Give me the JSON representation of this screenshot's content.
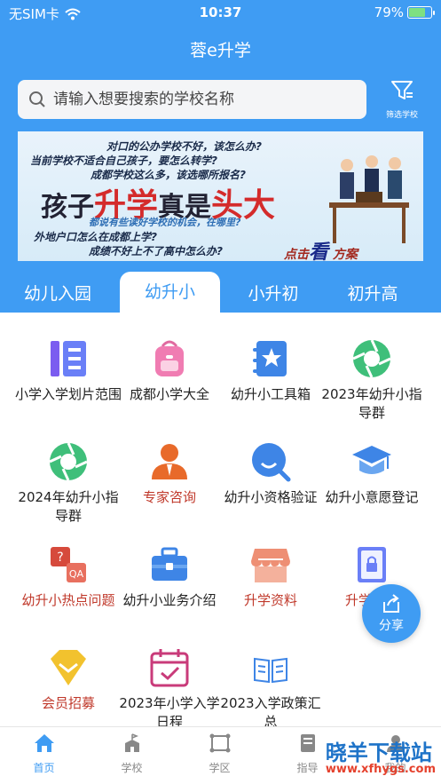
{
  "status": {
    "carrier": "无SIM卡",
    "time": "10:37",
    "battery": "79%",
    "battery_level": 0.79
  },
  "app": {
    "title": "蓉e升学"
  },
  "search": {
    "placeholder": "请输入想要搜索的学校名称",
    "filter_label": "筛选学校"
  },
  "banner": {
    "line1": "对口的公办学校不好，该怎么办?",
    "line2": "当前学校不适合自己孩子，要怎么转学?",
    "line3": "成都学校这么多，该选哪所报名?",
    "headline_a": "孩子",
    "headline_b": "升学",
    "headline_c": "真是",
    "headline_d": "头大",
    "line4": "都说有些读好学校的机会，在哪里?",
    "line5": "外地户口怎么在成都上学?",
    "line6": "成绩不好上不了高中怎么办?",
    "cta_a": "点击",
    "cta_b": "看",
    "cta_c": "方案"
  },
  "tabs": [
    {
      "label": "幼儿入园"
    },
    {
      "label": "幼升小"
    },
    {
      "label": "小升初"
    },
    {
      "label": "初升高"
    }
  ],
  "grid": [
    {
      "label": "小学入学划片范围",
      "icon": "document-list-icon"
    },
    {
      "label": "成都小学大全",
      "icon": "backpack-icon"
    },
    {
      "label": "幼升小工具箱",
      "icon": "star-notebook-icon"
    },
    {
      "label": "2023年幼升小指导群",
      "icon": "aperture-icon"
    },
    {
      "label": "2024年幼升小指导群",
      "icon": "aperture-icon"
    },
    {
      "label": "专家咨询",
      "icon": "expert-icon"
    },
    {
      "label": "幼升小资格验证",
      "icon": "search-bubble-icon"
    },
    {
      "label": "幼升小意愿登记",
      "icon": "graduation-cap-icon"
    },
    {
      "label": "幼升小热点问题",
      "icon": "qa-icon"
    },
    {
      "label": "幼升小业务介绍",
      "icon": "briefcase-icon"
    },
    {
      "label": "升学资料",
      "icon": "shop-icon"
    },
    {
      "label": "升学预约",
      "icon": "lock-book-icon"
    },
    {
      "label": "会员招募",
      "icon": "diamond-icon"
    },
    {
      "label": "2023年小学入学日程",
      "icon": "calendar-check-icon"
    },
    {
      "label": "2023入学政策汇总",
      "icon": "open-book-icon"
    }
  ],
  "share": {
    "label": "分享"
  },
  "nav": [
    {
      "label": "首页"
    },
    {
      "label": "学校"
    },
    {
      "label": "学区"
    },
    {
      "label": "指导"
    },
    {
      "label": "我的"
    }
  ],
  "watermark": {
    "main": "晓羊下载站",
    "url": "www.xfhygs.com"
  },
  "colors": {
    "primary": "#3f9cf3",
    "accent_red": "#c0392b"
  }
}
